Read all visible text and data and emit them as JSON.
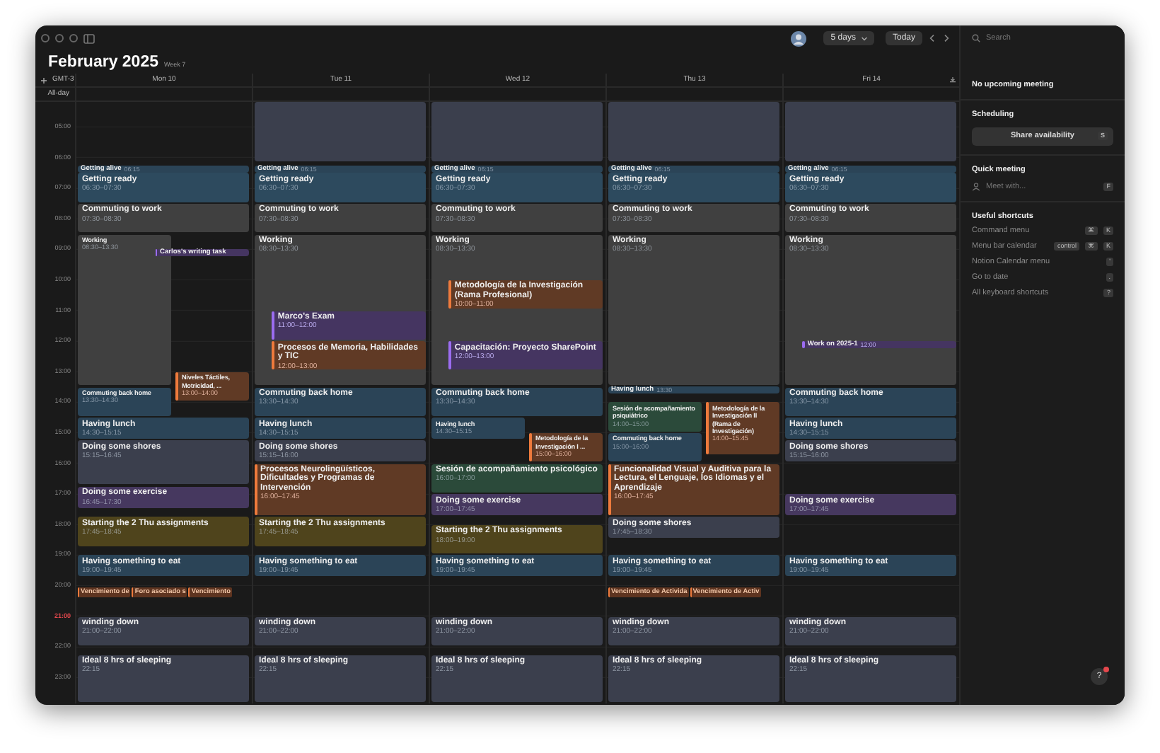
{
  "header": {
    "title": "February 2025",
    "week": "Week 7",
    "view": "5 days",
    "today": "Today",
    "timezone": "GMT-3",
    "allday": "All-day"
  },
  "hours": [
    {
      "label": "05:00",
      "current": false
    },
    {
      "label": "06:00",
      "current": false
    },
    {
      "label": "07:00",
      "current": false
    },
    {
      "label": "08:00",
      "current": false
    },
    {
      "label": "09:00",
      "current": false
    },
    {
      "label": "10:00",
      "current": false
    },
    {
      "label": "11:00",
      "current": false
    },
    {
      "label": "12:00",
      "current": false
    },
    {
      "label": "13:00",
      "current": false
    },
    {
      "label": "14:00",
      "current": false
    },
    {
      "label": "15:00",
      "current": false
    },
    {
      "label": "16:00",
      "current": false
    },
    {
      "label": "17:00",
      "current": false
    },
    {
      "label": "18:00",
      "current": false
    },
    {
      "label": "19:00",
      "current": false
    },
    {
      "label": "20:00",
      "current": false
    },
    {
      "label": "21:00",
      "current": true
    },
    {
      "label": "22:00",
      "current": false
    },
    {
      "label": "23:00",
      "current": false
    }
  ],
  "days": [
    {
      "label": "Mon 10",
      "events": [
        {
          "kind": "reminder",
          "title": "Getting alive",
          "time": "06:15",
          "color": "#2b4457",
          "striped": false
        },
        {
          "kind": "range",
          "title": "Getting ready",
          "time": "06:30–07:30",
          "color": "#2d4a5e",
          "striped": false
        },
        {
          "kind": "range",
          "title": "Commuting to work",
          "time": "07:30–08:30",
          "color": "#404040",
          "striped": false
        },
        {
          "kind": "range",
          "title": "Working",
          "time": "08:30–13:30",
          "color": "#404040",
          "striped": false
        },
        {
          "kind": "reminder",
          "title": "Carlos's writing task",
          "color": "#9b6cf0",
          "striped": true
        },
        {
          "kind": "range",
          "title": "Niveles Táctiles, Motricidad, ...",
          "time": "13:00–14:00",
          "color": "#ee7a3c",
          "striped": true
        },
        {
          "kind": "range",
          "title": "Commuting back home",
          "time": "13:30–14:30",
          "color": "#2b4457",
          "striped": false
        },
        {
          "kind": "range",
          "title": "Having lunch",
          "time": "14:30–15:15",
          "color": "#2b4457",
          "striped": false
        },
        {
          "kind": "range",
          "title": "Doing some shores",
          "time": "15:15–16:45",
          "color": "#3b3f4d",
          "striped": false
        },
        {
          "kind": "range",
          "title": "Doing some exercise",
          "time": "16:45–17:30",
          "color": "#46385f",
          "striped": false
        },
        {
          "kind": "range",
          "title": "Starting the 2 Thu assignments",
          "time": "17:45–18:45",
          "color": "#4f441c",
          "striped": false
        },
        {
          "kind": "range",
          "title": "Having something to eat",
          "time": "19:00–19:45",
          "color": "#2b4457",
          "striped": false
        },
        {
          "kind": "range",
          "title": "winding down",
          "time": "21:00–22:00",
          "color": "#3b3f4d",
          "striped": false
        },
        {
          "kind": "overnight",
          "title": "Ideal 8 hrs of sleeping",
          "time": "22:15",
          "color": "#3b3f4d",
          "striped": false
        }
      ],
      "deadlines": [
        "Vencimiento de",
        "Foro asociado s",
        "Vencimiento"
      ]
    },
    {
      "label": "Tue 11",
      "events": [
        {
          "kind": "busy",
          "color": "#3b3f4d",
          "striped": false
        },
        {
          "kind": "reminder",
          "title": "Getting alive",
          "time": "06:15",
          "color": "#2b4457",
          "striped": false
        },
        {
          "kind": "range",
          "title": "Getting ready",
          "time": "06:30–07:30",
          "color": "#2d4a5e",
          "striped": false
        },
        {
          "kind": "range",
          "title": "Commuting to work",
          "time": "07:30–08:30",
          "color": "#404040",
          "striped": false
        },
        {
          "kind": "range",
          "title": "Working",
          "time": "08:30–13:30",
          "color": "#404040",
          "striped": false
        },
        {
          "kind": "range",
          "title": "Marco's Exam",
          "time": "11:00–12:00",
          "color": "#9b6cf0",
          "striped": true
        },
        {
          "kind": "range",
          "title": "Procesos de Memoria, Habilidades y TIC",
          "time": "12:00–13:00",
          "color": "#ee7a3c",
          "striped": true
        },
        {
          "kind": "range",
          "title": "Commuting back home",
          "time": "13:30–14:30",
          "color": "#2b4457",
          "striped": false
        },
        {
          "kind": "range",
          "title": "Having lunch",
          "time": "14:30–15:15",
          "color": "#2b4457",
          "striped": false
        },
        {
          "kind": "range",
          "title": "Doing some shores",
          "time": "15:15–16:00",
          "color": "#3b3f4d",
          "striped": false
        },
        {
          "kind": "range",
          "title": "Procesos Neurolingüísticos, Dificultades y Programas de Intervención",
          "time": "16:00–17:45",
          "color": "#ee7a3c",
          "striped": true
        },
        {
          "kind": "range",
          "title": "Starting the 2 Thu assignments",
          "time": "17:45–18:45",
          "color": "#4f441c",
          "striped": false
        },
        {
          "kind": "range",
          "title": "Having something to eat",
          "time": "19:00–19:45",
          "color": "#2b4457",
          "striped": false
        },
        {
          "kind": "range",
          "title": "winding down",
          "time": "21:00–22:00",
          "color": "#3b3f4d",
          "striped": false
        },
        {
          "kind": "overnight",
          "title": "Ideal 8 hrs of sleeping",
          "time": "22:15",
          "color": "#3b3f4d",
          "striped": false
        }
      ]
    },
    {
      "label": "Wed 12",
      "events": [
        {
          "kind": "busy",
          "color": "#3b3f4d",
          "striped": false
        },
        {
          "kind": "reminder",
          "title": "Getting alive",
          "time": "06:15",
          "color": "#2b4457",
          "striped": false
        },
        {
          "kind": "range",
          "title": "Getting ready",
          "time": "06:30–07:30",
          "color": "#2d4a5e",
          "striped": false
        },
        {
          "kind": "range",
          "title": "Commuting to work",
          "time": "07:30–08:30",
          "color": "#404040",
          "striped": false
        },
        {
          "kind": "range",
          "title": "Working",
          "time": "08:30–13:30",
          "color": "#404040",
          "striped": false
        },
        {
          "kind": "range",
          "title": "Metodología de la Investigación (Rama Profesional)",
          "time": "10:00–11:00",
          "color": "#ee7a3c",
          "striped": true
        },
        {
          "kind": "range",
          "title": "Capacitación: Proyecto SharePoint",
          "time": "12:00–13:00",
          "color": "#9b6cf0",
          "striped": true
        },
        {
          "kind": "range",
          "title": "Commuting back home",
          "time": "13:30–14:30",
          "color": "#2b4457",
          "striped": false
        },
        {
          "kind": "range",
          "title": "Having lunch",
          "time": "14:30–15:15",
          "color": "#2b4457",
          "striped": false
        },
        {
          "kind": "range",
          "title": "Metodología de la Investigación I ...",
          "time": "15:00–16:00",
          "color": "#ee7a3c",
          "striped": true
        },
        {
          "kind": "range",
          "title": "Sesión de acompañamiento psicológico",
          "time": "16:00–17:00",
          "color": "#2b4a3a",
          "striped": false
        },
        {
          "kind": "range",
          "title": "Doing some exercise",
          "time": "17:00–17:45",
          "color": "#46385f",
          "striped": false
        },
        {
          "kind": "range",
          "title": "Starting the 2 Thu assignments",
          "time": "18:00–19:00",
          "color": "#4f441c",
          "striped": false
        },
        {
          "kind": "range",
          "title": "Having something to eat",
          "time": "19:00–19:45",
          "color": "#2b4457",
          "striped": false
        },
        {
          "kind": "range",
          "title": "winding down",
          "time": "21:00–22:00",
          "color": "#3b3f4d",
          "striped": false
        },
        {
          "kind": "overnight",
          "title": "Ideal 8 hrs of sleeping",
          "time": "22:15",
          "color": "#3b3f4d",
          "striped": false
        }
      ]
    },
    {
      "label": "Thu 13",
      "events": [
        {
          "kind": "busy",
          "color": "#3b3f4d",
          "striped": false
        },
        {
          "kind": "reminder",
          "title": "Getting alive",
          "time": "06:15",
          "color": "#2b4457",
          "striped": false
        },
        {
          "kind": "range",
          "title": "Getting ready",
          "time": "06:30–07:30",
          "color": "#2d4a5e",
          "striped": false
        },
        {
          "kind": "range",
          "title": "Commuting to work",
          "time": "07:30–08:30",
          "color": "#404040",
          "striped": false
        },
        {
          "kind": "range",
          "title": "Working",
          "time": "08:30–13:30",
          "color": "#404040",
          "striped": false
        },
        {
          "kind": "reminder",
          "title": "Having lunch",
          "time": "13:30",
          "color": "#2b4457",
          "striped": false
        },
        {
          "kind": "range",
          "title": "Sesión de acompañamiento psiquiátrico",
          "time": "14:00–15:00",
          "color": "#2b4a3a",
          "striped": false
        },
        {
          "kind": "range",
          "title": "Metodología de la Investigación II (Rama de Investigación)",
          "time": "14:00–15:45",
          "color": "#ee7a3c",
          "striped": true
        },
        {
          "kind": "range",
          "title": "Commuting back home",
          "time": "15:00–16:00",
          "color": "#2b4457",
          "striped": false
        },
        {
          "kind": "range",
          "title": "Funcionalidad Visual y Auditiva para la Lectura, el Lenguaje, los Idiomas y el Aprendizaje",
          "time": "16:00–17:45",
          "color": "#ee7a3c",
          "striped": true
        },
        {
          "kind": "range",
          "title": "Doing some shores",
          "time": "17:45–18:30",
          "color": "#3b3f4d",
          "striped": false
        },
        {
          "kind": "range",
          "title": "Having something to eat",
          "time": "19:00–19:45",
          "color": "#2b4457",
          "striped": false
        },
        {
          "kind": "range",
          "title": "winding down",
          "time": "21:00–22:00",
          "color": "#3b3f4d",
          "striped": false
        },
        {
          "kind": "overnight",
          "title": "Ideal 8 hrs of sleeping",
          "time": "22:15",
          "color": "#3b3f4d",
          "striped": false
        }
      ],
      "deadlines": [
        "Vencimiento de Activida",
        "Vencimiento de Activ"
      ]
    },
    {
      "label": "Fri 14",
      "events": [
        {
          "kind": "busy",
          "color": "#3b3f4d",
          "striped": false
        },
        {
          "kind": "reminder",
          "title": "Getting alive",
          "time": "06:15",
          "color": "#2b4457",
          "striped": false
        },
        {
          "kind": "range",
          "title": "Getting ready",
          "time": "06:30–07:30",
          "color": "#2d4a5e",
          "striped": false
        },
        {
          "kind": "range",
          "title": "Commuting to work",
          "time": "07:30–08:30",
          "color": "#404040",
          "striped": false
        },
        {
          "kind": "range",
          "title": "Working",
          "time": "08:30–13:30",
          "color": "#404040",
          "striped": false
        },
        {
          "kind": "reminder",
          "title": "Work on 2025-1",
          "time": "12:00",
          "color": "#9b6cf0",
          "striped": true
        },
        {
          "kind": "range",
          "title": "Commuting back home",
          "time": "13:30–14:30",
          "color": "#2b4457",
          "striped": false
        },
        {
          "kind": "range",
          "title": "Having lunch",
          "time": "14:30–15:15",
          "color": "#2b4457",
          "striped": false
        },
        {
          "kind": "range",
          "title": "Doing some shores",
          "time": "15:15–16:00",
          "color": "#3b3f4d",
          "striped": false
        },
        {
          "kind": "range",
          "title": "Doing some exercise",
          "time": "17:00–17:45",
          "color": "#46385f",
          "striped": false
        },
        {
          "kind": "range",
          "title": "Having something to eat",
          "time": "19:00–19:45",
          "color": "#2b4457",
          "striped": false
        },
        {
          "kind": "range",
          "title": "winding down",
          "time": "21:00–22:00",
          "color": "#3b3f4d",
          "striped": false
        },
        {
          "kind": "overnight",
          "title": "Ideal 8 hrs of sleeping",
          "time": "22:15",
          "color": "#3b3f4d",
          "striped": false
        }
      ]
    }
  ],
  "sidebar": {
    "search": {
      "placeholder": "Search"
    },
    "upcoming": "No upcoming meeting",
    "scheduling": {
      "title": "Scheduling",
      "button": "Share availability",
      "key": "S"
    },
    "quick_meeting": {
      "title": "Quick meeting",
      "placeholder": "Meet with...",
      "key": "F"
    },
    "shortcuts": {
      "title": "Useful shortcuts",
      "items": [
        {
          "label": "Command menu",
          "keys": [
            "⌘",
            "K"
          ]
        },
        {
          "label": "Menu bar calendar",
          "keys": [
            "control",
            "⌘",
            "K"
          ]
        },
        {
          "label": "Notion Calendar menu",
          "keys": [
            "'"
          ]
        },
        {
          "label": "Go to date",
          "keys": [
            "."
          ]
        },
        {
          "label": "All keyboard shortcuts",
          "keys": [
            "?"
          ]
        }
      ]
    }
  },
  "help": "?"
}
